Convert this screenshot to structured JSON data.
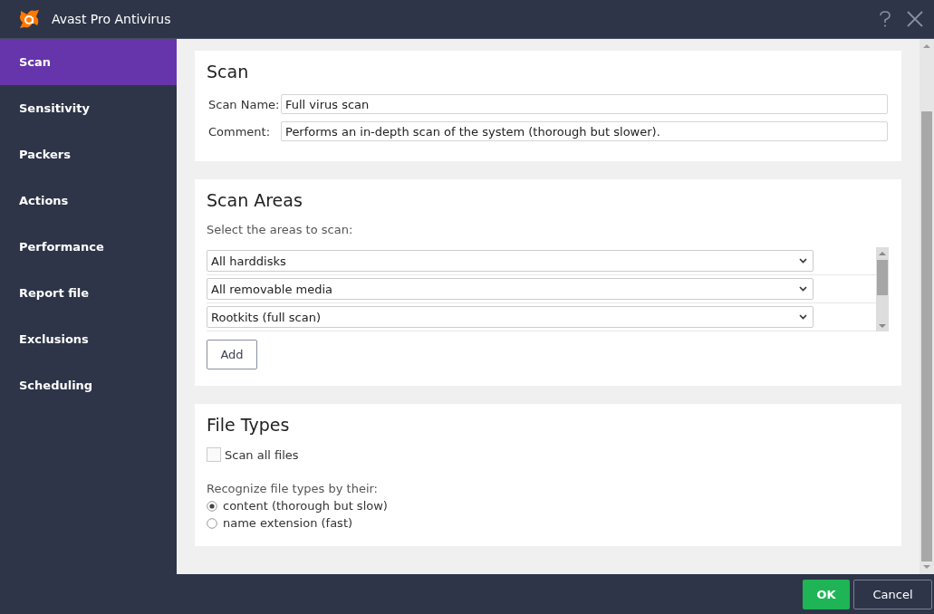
{
  "window": {
    "title": "Avast Pro Antivirus"
  },
  "sidebar": {
    "items": [
      {
        "label": "Scan",
        "selected": true
      },
      {
        "label": "Sensitivity",
        "selected": false
      },
      {
        "label": "Packers",
        "selected": false
      },
      {
        "label": "Actions",
        "selected": false
      },
      {
        "label": "Performance",
        "selected": false
      },
      {
        "label": "Report file",
        "selected": false
      },
      {
        "label": "Exclusions",
        "selected": false
      },
      {
        "label": "Scheduling",
        "selected": false
      }
    ]
  },
  "scan": {
    "heading": "Scan",
    "fields": [
      {
        "label": "Scan Name:",
        "value": "Full virus scan"
      },
      {
        "label": "Comment:",
        "value": "Performs an in-depth scan of the system (thorough but slower)."
      }
    ]
  },
  "scan_areas": {
    "heading": "Scan Areas",
    "hint": "Select the areas to scan:",
    "areas": [
      {
        "value": "All harddisks"
      },
      {
        "value": "All removable media"
      },
      {
        "value": "Rootkits (full scan)"
      }
    ],
    "add_button": "Add"
  },
  "file_types": {
    "heading": "File Types",
    "scan_all": {
      "label": "Scan all files",
      "checked": false
    },
    "recognize_label": "Recognize file types by their:",
    "options": [
      {
        "label": "content (thorough but slow)",
        "selected": true
      },
      {
        "label": "name extension (fast)",
        "selected": false
      }
    ]
  },
  "buttons": {
    "ok": "OK",
    "cancel": "Cancel"
  }
}
